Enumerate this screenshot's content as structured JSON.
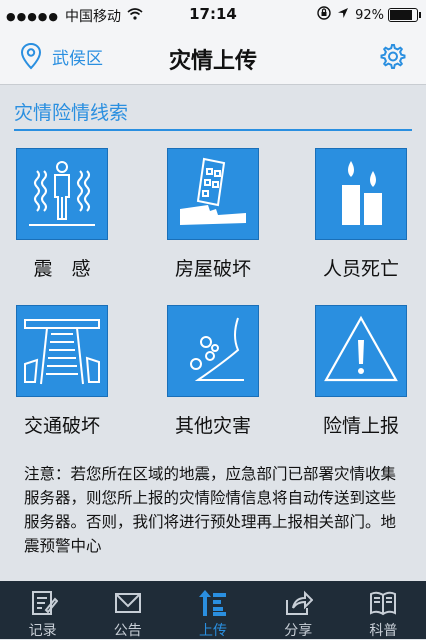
{
  "status_bar": {
    "carrier": "中国移动",
    "time": "17:14",
    "battery_text": "92%",
    "battery_level": 0.92
  },
  "nav": {
    "location": "武侯区",
    "title": "灾情上传"
  },
  "section": {
    "title": "灾情险情线索"
  },
  "items": [
    {
      "label": "震　感",
      "icon": "person-shaking-icon"
    },
    {
      "label": "房屋破坏",
      "icon": "collapsed-building-icon"
    },
    {
      "label": "人员死亡",
      "icon": "candles-icon"
    },
    {
      "label": "交通破坏",
      "icon": "broken-rail-icon"
    },
    {
      "label": "其他灾害",
      "icon": "landslide-icon"
    },
    {
      "label": "险情上报",
      "icon": "warning-triangle-icon"
    }
  ],
  "notice": "注意：若您所在区域的地震，应急部门已部署灾情收集服务器，则您所上报的灾情险情信息将自动传送到这些服务器。否则，我们将进行预处理再上报相关部门。地震预警中心",
  "tabs": [
    {
      "label": "记录",
      "icon": "record-icon",
      "active": false
    },
    {
      "label": "公告",
      "icon": "mail-icon",
      "active": false
    },
    {
      "label": "上传",
      "icon": "upload-icon",
      "active": true
    },
    {
      "label": "分享",
      "icon": "share-icon",
      "active": false
    },
    {
      "label": "科普",
      "icon": "book-icon",
      "active": false
    }
  ],
  "colors": {
    "accent": "#2a8fe0",
    "tab_bar": "#1f2c38",
    "background": "#dfe3e8"
  }
}
